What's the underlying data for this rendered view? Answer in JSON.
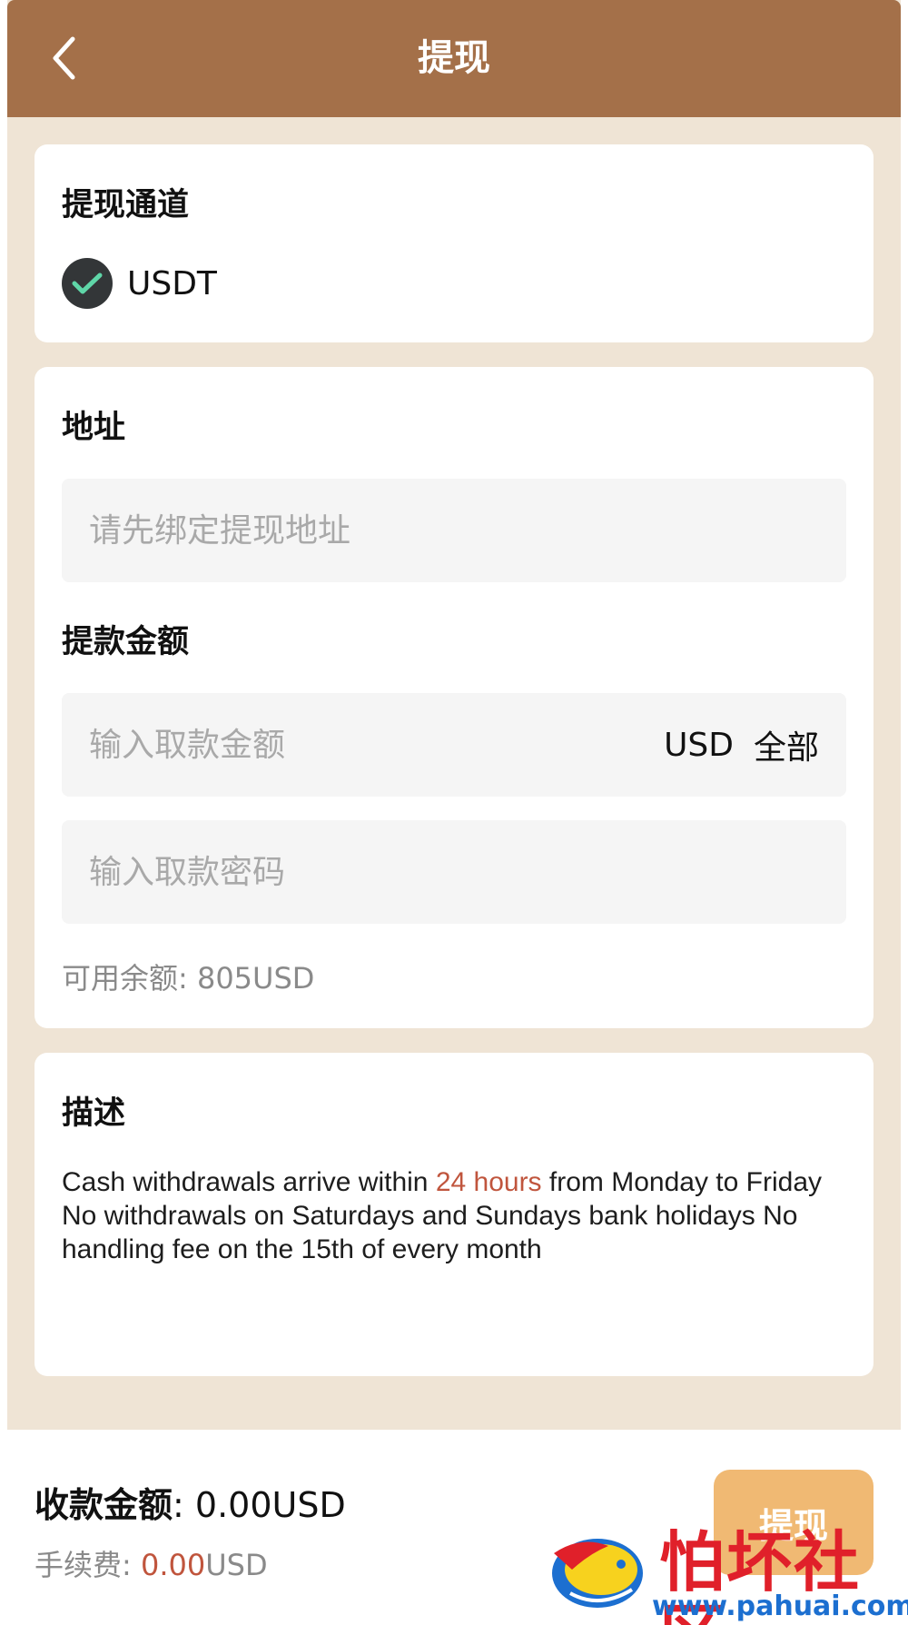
{
  "header": {
    "title": "提现"
  },
  "channel": {
    "heading": "提现通道",
    "option": "USDT"
  },
  "form": {
    "address_heading": "地址",
    "address_placeholder": "请先绑定提现地址",
    "amount_heading": "提款金额",
    "amount_placeholder": "输入取款金额",
    "currency": "USD",
    "all_label": "全部",
    "password_placeholder": "输入取款密码",
    "balance_text": "可用余额: 805USD"
  },
  "description": {
    "heading": "描述",
    "text_before": "Cash withdrawals arrive within ",
    "highlight": "24 hours",
    "text_after": " from Monday to Friday No withdrawals on Saturdays and Sundays bank holidays No handling fee on the 15th of every month"
  },
  "footer": {
    "receive_label": "收款金额",
    "receive_value": ": 0.00USD",
    "fee_label": "手续费:",
    "fee_value": " 0.00",
    "fee_unit": "USD",
    "submit_label": "提现"
  },
  "watermark": {
    "brand": "怕坏社区",
    "url": "www.pahuai.com"
  },
  "colors": {
    "header": "#a47049",
    "background": "#efe4d5",
    "accent_check": "#5fd6a8",
    "highlight": "#c0553d",
    "submit": "#f0b973"
  }
}
